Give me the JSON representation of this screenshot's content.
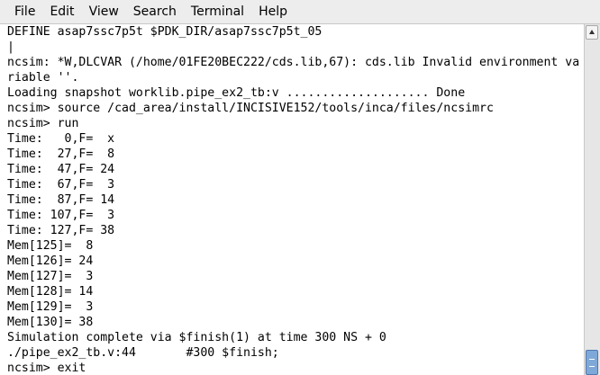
{
  "menu": {
    "file": "File",
    "edit": "Edit",
    "view": "View",
    "search": "Search",
    "terminal": "Terminal",
    "help": "Help"
  },
  "terminal": {
    "lines": [
      "DEFINE asap7ssc7p5t $PDK_DIR/asap7ssc7p5t_05",
      "|",
      "ncsim: *W,DLCVAR (/home/01FE20BEC222/cds.lib,67): cds.lib Invalid environment va",
      "riable ''.",
      "Loading snapshot worklib.pipe_ex2_tb:v .................... Done",
      "ncsim> source /cad_area/install/INCISIVE152/tools/inca/files/ncsimrc",
      "ncsim> run",
      "Time:   0,F=  x",
      "Time:  27,F=  8",
      "Time:  47,F= 24",
      "Time:  67,F=  3",
      "Time:  87,F= 14",
      "Time: 107,F=  3",
      "Time: 127,F= 38",
      "Mem[125]=  8",
      "Mem[126]= 24",
      "Mem[127]=  3",
      "Mem[128]= 14",
      "Mem[129]=  3",
      "Mem[130]= 38",
      "Simulation complete via $finish(1) at time 300 NS + 0",
      "./pipe_ex2_tb.v:44       #300 $finish;",
      "ncsim> exit"
    ]
  },
  "colors": {
    "menubar_bg": "#ededed",
    "terminal_bg": "#ffffff",
    "text": "#000000",
    "scroll_thumb": "#7ea8d8"
  }
}
